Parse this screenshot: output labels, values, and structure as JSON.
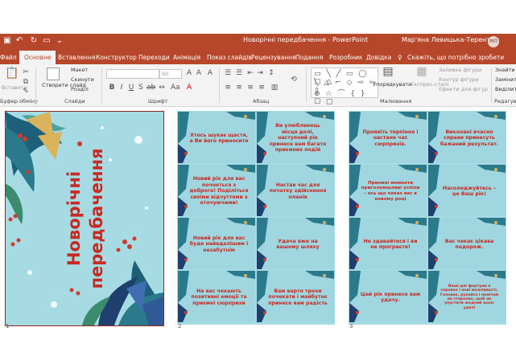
{
  "window": {
    "title": "Новорічні передбачення  -  PowerPoint",
    "user": "Мар'яна Левицька-Терентюк",
    "avatar_initials": "МЛ"
  },
  "tabs": [
    "Файл",
    "Основне",
    "Вставлення",
    "Конструктор",
    "Переходи",
    "Анімація",
    "Показ слайдів",
    "Рецензування",
    "Подання",
    "Розробник",
    "Довідка"
  ],
  "tell_me": "Скажіть, що потрібно зробити",
  "ribbon": {
    "clipboard": {
      "paste": "Вставити",
      "label": "Буфер обміну"
    },
    "slides": {
      "new_slide": "Створити слайд",
      "layout": "Макет",
      "reset": "Скинути",
      "section": "Розділ",
      "label": "Слайди"
    },
    "font": {
      "size": "60",
      "label": "Шрифт"
    },
    "paragraph": {
      "label": "Абзац"
    },
    "drawing": {
      "arrange": "Упорядкувати",
      "quick_styles": "Експрес-стилі",
      "fill": "Заливка фігури",
      "outline": "Контур фігури",
      "effects": "Ефекти для фігур",
      "label": "Малювання"
    },
    "editing": {
      "find": "Знайти",
      "replace": "Замінити",
      "select": "Виділити",
      "label": "Редагування"
    }
  },
  "slides": [
    {
      "number": "1",
      "title_line1": "Новорічні",
      "title_line2": "передбачення"
    },
    {
      "number": "2",
      "cards": [
        "Хтось шукає щастя, а Ви його приносите",
        "Ви улюбленець місця долі, наступний рік принесе вам багато приємних подій",
        "Новий рік для вас почнеться з доброго! Поділіться своїми відчуттями з оточуючими!",
        "Настав час для початку здійснення планів",
        "Новий рік для вас буде найвдалішим і незабутнім",
        "Удача вже на вашому шляху",
        "На вас чекають позитивні емоції та приємні сюрпризи",
        "Вам варто трохи почекати і майбутнє принесе вам радість"
      ]
    },
    {
      "number": "3",
      "cards": [
        "Проявіть терпіння і настане час сюрпризів.",
        "Виконані вчасно справи принесуть бажаний результат.",
        "Приємні моменти приголомшливі успіхи – ось що чекає вас в новому році",
        "Насолоджуйтесь – це Ваш рік!",
        "Не здавайтеся і ви не програєте!",
        "Вас чекає цікава подорож.",
        "Цей рік принесе вам удачу.",
        "Ваші дні фортуни в справах і нові можливості. Головне, рухайся і помічай на сторонах, щоб не упустити жодний шанс удачі"
      ]
    }
  ],
  "colors": {
    "accent": "#b7472a",
    "slide_bg": "#a7dbe3",
    "card_text": "#c8281e"
  }
}
